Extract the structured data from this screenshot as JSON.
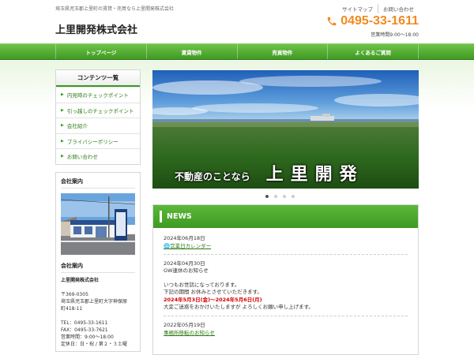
{
  "header": {
    "tagline": "埼玉県児玉郡上里町の賃貸・売買なら上里開発株式会社",
    "top_links": [
      "サイトマップ",
      "お問い合わせ"
    ],
    "company": "上里開発株式会社",
    "phone": "0495-33-1611",
    "hours": "営業時間9:00～18:00"
  },
  "nav": [
    "トップページ",
    "賃貸物件",
    "売買物件",
    "よくあるご質問"
  ],
  "sidebar": {
    "menu_title": "コンテンツ一覧",
    "menu_items": [
      "内見時のチェックポイント",
      "引っ越しのチェックポイント",
      "会社紹介",
      "プライバシーポリシー",
      "お問い合わせ"
    ],
    "info_heading": "会社案内",
    "info_heading2": "会社案内",
    "info_name": "上里開発株式会社",
    "info_lines": [
      "〒369-0305",
      "埼玉県児玉郡上里町大字神保原",
      "町418-11",
      "",
      "TEL：0495-33-1611",
      "FAX：0495-33-7621",
      "営業時間：9:00～18:00",
      "定休日：日・祝 / 第２・３土曜"
    ]
  },
  "slider": {
    "caption_small": "不動産のことなら",
    "caption_big": "上里開発"
  },
  "news": {
    "title": "NEWS",
    "entries": [
      {
        "date": "2024年06月18日",
        "link": "🌐営業日カレンダー"
      },
      {
        "date": "2024年04月30日",
        "heading": "GW連休のお知らせ",
        "line1": "いつもお世話になっております。",
        "line2": "下記の期間 お休みとさせていただきます。",
        "red": "2024年5月3日(金)～2024年5月6日(月)",
        "line3": "大変ご迷惑をおかけいたしますが よろしくお願い申し上げます。"
      },
      {
        "date": "2022年05月19日",
        "link": "事務所移転のお知らせ"
      }
    ]
  },
  "colors": {
    "brand_green": "#3e9a22",
    "phone_orange": "#f28a1f",
    "alert_red": "#d40000"
  }
}
